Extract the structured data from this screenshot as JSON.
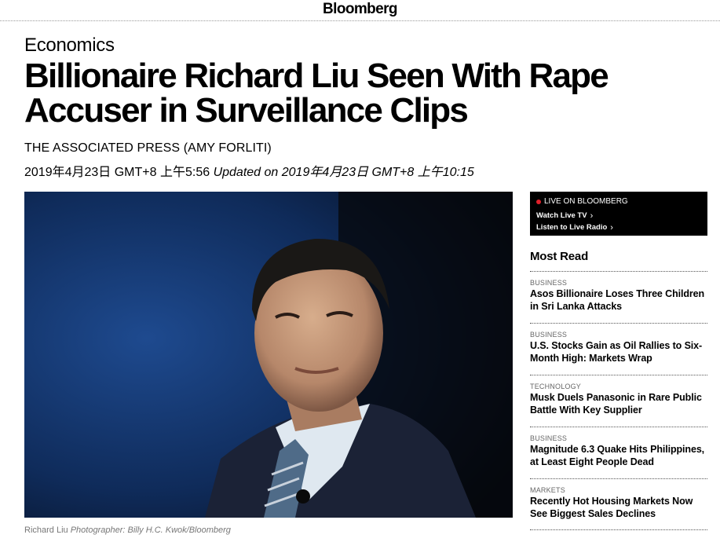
{
  "header": {
    "logo": "Bloomberg"
  },
  "article": {
    "section": "Economics",
    "headline": "Billionaire Richard Liu Seen With Rape Accuser in Surveillance Clips",
    "byline": "THE ASSOCIATED PRESS (AMY FORLITI)",
    "published": "2019年4月23日 GMT+8 上午5:56",
    "updated": "Updated on 2019年4月23日 GMT+8 上午10:15",
    "image": {
      "caption_subject": "Richard Liu",
      "caption_credit": "Photographer: Billy H.C. Kwok/Bloomberg"
    }
  },
  "live": {
    "label": "LIVE ON BLOOMBERG",
    "watch": "Watch Live TV",
    "listen": "Listen to Live Radio",
    "accent": "#e0202a"
  },
  "most_read": {
    "title": "Most Read",
    "items": [
      {
        "category": "BUSINESS",
        "headline": "Asos Billionaire Loses Three Children in Sri Lanka Attacks"
      },
      {
        "category": "BUSINESS",
        "headline": "U.S. Stocks Gain as Oil Rallies to Six-Month High: Markets Wrap"
      },
      {
        "category": "TECHNOLOGY",
        "headline": "Musk Duels Panasonic in Rare Public Battle With Key Supplier"
      },
      {
        "category": "BUSINESS",
        "headline": "Magnitude 6.3 Quake Hits Philippines, at Least Eight People Dead"
      },
      {
        "category": "MARKETS",
        "headline": "Recently Hot Housing Markets Now See Biggest Sales Declines"
      }
    ]
  }
}
